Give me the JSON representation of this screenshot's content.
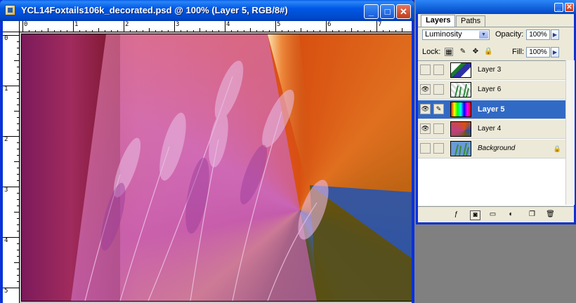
{
  "document": {
    "title": "YCL14Foxtails106k_decorated.psd @ 100% (Layer 5, RGB/8#)",
    "ruler_h_labels": [
      "0",
      "1",
      "2",
      "3",
      "4",
      "5",
      "6",
      "7"
    ],
    "ruler_v_labels": [
      "0",
      "1",
      "2",
      "3",
      "4",
      "5"
    ],
    "minimize_label": "_",
    "maximize_label": "□",
    "close_label": "✕"
  },
  "layers_panel": {
    "tabs": [
      {
        "label": "Layers"
      },
      {
        "label": "Paths"
      }
    ],
    "blend_mode": "Luminosity",
    "opacity_label": "Opacity:",
    "opacity_value": "100%",
    "lock_label": "Lock:",
    "fill_label": "Fill:",
    "fill_value": "100%",
    "layers": [
      {
        "name": "Layer 3",
        "visible": false,
        "selected": false
      },
      {
        "name": "Layer 6",
        "visible": true,
        "selected": false
      },
      {
        "name": "Layer 5",
        "visible": true,
        "selected": true
      },
      {
        "name": "Layer 4",
        "visible": true,
        "selected": false
      },
      {
        "name": "Background",
        "visible": false,
        "selected": false,
        "locked": true
      }
    ]
  },
  "colors": {
    "titlebar_blue": "#0058e6",
    "selection_blue": "#316ac5",
    "panel_bg": "#ece9d8"
  }
}
